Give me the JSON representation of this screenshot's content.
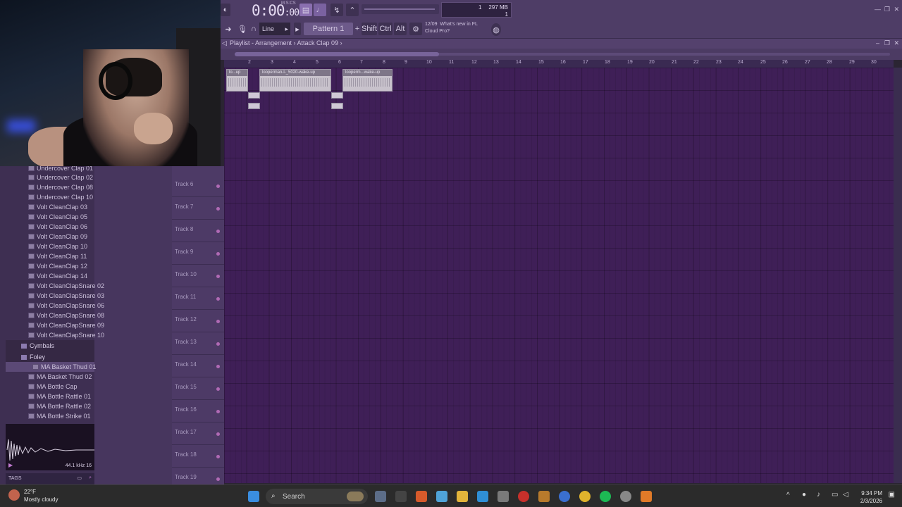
{
  "toolbar": {
    "time_main": "0:00",
    "time_small": "00",
    "time_sub": "M:S:CS",
    "snap": "Line",
    "pattern": "Pattern 1",
    "modifiers": [
      "Shift",
      "Ctrl",
      "Alt"
    ],
    "news_date": "12/09",
    "news_line1": "What's new in FL",
    "news_line2": "Cloud Pro?",
    "cpu_num": "1",
    "memory": "297 MB",
    "cpu_num2": "1"
  },
  "playlist": {
    "breadcrumb": "Playlist - Arrangement › Attack Clap 09 ›",
    "ruler": [
      "2",
      "3",
      "4",
      "5",
      "6",
      "7",
      "8",
      "9",
      "10",
      "11",
      "12",
      "13",
      "14",
      "15",
      "16",
      "17",
      "18",
      "19",
      "20",
      "21",
      "22",
      "23",
      "24",
      "25",
      "26",
      "27",
      "28",
      "29",
      "30"
    ],
    "clips": [
      "lo...up",
      "looperman-l-_5020-wake-up",
      "looperm...wake-up"
    ],
    "tracks": [
      "Track 6",
      "Track 7",
      "Track 8",
      "Track 9",
      "Track 10",
      "Track 11",
      "Track 12",
      "Track 13",
      "Track 14",
      "Track 15",
      "Track 16",
      "Track 17",
      "Track 18",
      "Track 19"
    ]
  },
  "browser": {
    "items_top": [
      "Undercover Clap 01",
      "Undercover Clap 02",
      "Undercover Clap 08",
      "Undercover Clap 10",
      "Volt CleanClap 03",
      "Volt CleanClap 05",
      "Volt CleanClap 06",
      "Volt CleanClap 09",
      "Volt CleanClap 10",
      "Volt CleanClap 11",
      "Volt CleanClap 12",
      "Volt CleanClap 14",
      "Volt CleanClapSnare 02",
      "Volt CleanClapSnare 03",
      "Volt CleanClapSnare 06",
      "Volt CleanClapSnare 08",
      "Volt CleanClapSnare 09",
      "Volt CleanClapSnare 10"
    ],
    "folder_cymbals": "Cymbals",
    "folder_foley": "Foley",
    "items_foley": [
      "MA Basket Thud 01",
      "MA Basket Thud 02",
      "MA Bottle Cap",
      "MA Bottle Rattle 01",
      "MA Bottle Rattle 02",
      "MA Bottle Strike 01"
    ],
    "sample_info": "44.1 kHz 16",
    "tags": "TAGS"
  },
  "taskbar": {
    "temp": "22°F",
    "weather": "Mostly cloudy",
    "search": "Search",
    "time": "9:34 PM",
    "date": "2/3/2026"
  }
}
